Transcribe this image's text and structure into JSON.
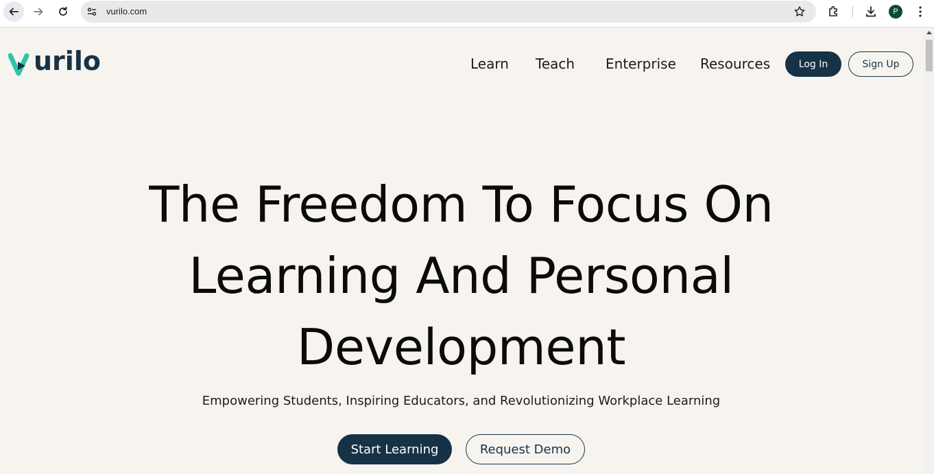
{
  "browser": {
    "url": "vurilo.com",
    "profile_initial": "P",
    "icons": [
      "back-arrow-icon",
      "forward-arrow-icon",
      "reload-icon",
      "site-settings-icon",
      "bookmark-star-icon",
      "extensions-icon",
      "download-icon",
      "more-menu-icon"
    ]
  },
  "site": {
    "logo_text": "urilo",
    "nav": {
      "items": [
        "Learn",
        "Teach",
        "Enterprise",
        "Resources"
      ],
      "login_label": "Log In",
      "signup_label": "Sign Up"
    },
    "hero": {
      "lines": [
        "The Freedom To Focus On",
        "Learning And Personal",
        "Development"
      ],
      "subtitle": "Empowering Students, Inspiring Educators, and Revolutionizing Workplace Learning",
      "primary_cta": "Start Learning",
      "secondary_cta": "Request Demo"
    }
  },
  "colors": {
    "brand_dark": "#163246",
    "brand_teal": "#2ec4a5",
    "background": "#f7f4ef"
  }
}
